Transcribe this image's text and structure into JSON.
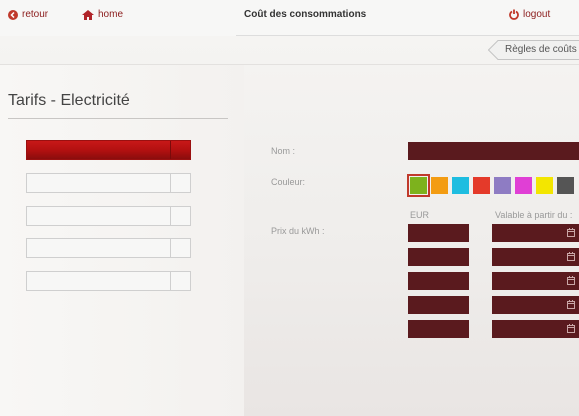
{
  "header": {
    "back_label": "retour",
    "home_label": "home",
    "title": "Coût des consommations",
    "logout_label": "logout",
    "rules_button_label": "Règles de coûts"
  },
  "left": {
    "section_title": "Tarifs - Electricité",
    "items_count_visible": 5,
    "active_index": 0
  },
  "form": {
    "name_label": "Nom :",
    "name_value": "",
    "color_label": "Couleur:",
    "price_label": "Prix du kWh :",
    "col_eur": "EUR",
    "col_valid": "Valable à partir du :",
    "colors": [
      "#7db21d",
      "#f39c12",
      "#1ebde0",
      "#e43a2a",
      "#8e7cc3",
      "#e03fd5",
      "#f3e600",
      "#555555"
    ],
    "selected_color_index": 0,
    "price_rows": [
      {
        "eur": "",
        "date": ""
      },
      {
        "eur": "",
        "date": ""
      },
      {
        "eur": "",
        "date": ""
      },
      {
        "eur": "",
        "date": ""
      },
      {
        "eur": "",
        "date": ""
      }
    ]
  },
  "theme": {
    "accent": "#8b1c1c",
    "field_bg": "#5a1a1e",
    "active_item": "#c81818"
  }
}
